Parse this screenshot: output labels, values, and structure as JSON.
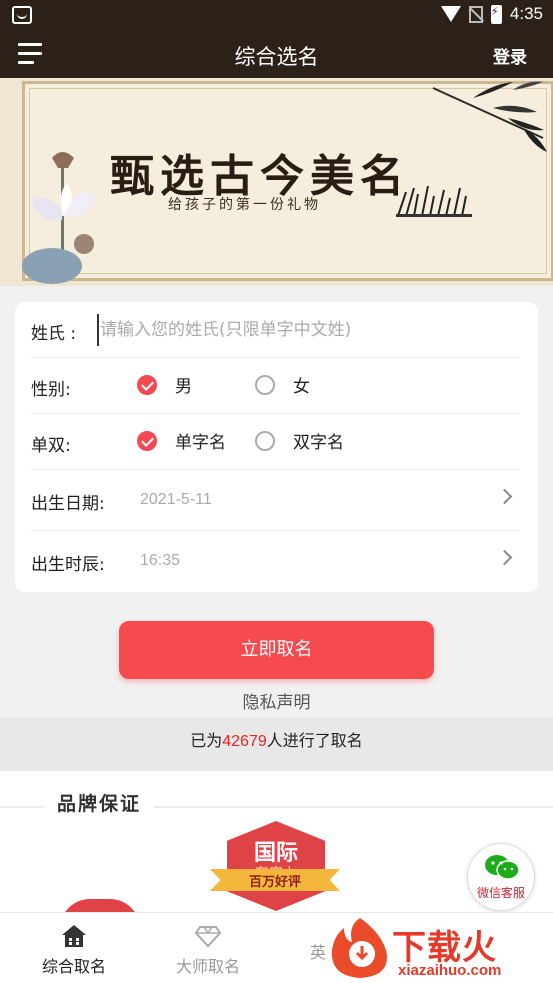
{
  "status_bar": {
    "time": "4:35"
  },
  "app_bar": {
    "title": "综合选名",
    "login_label": "登录"
  },
  "banner": {
    "headline": "甄选古今美名",
    "subline": "给孩子的第一份礼物"
  },
  "form": {
    "surname": {
      "label": "姓氏 :",
      "placeholder": "请输入您的姓氏(只限单字中文姓)",
      "value": ""
    },
    "gender": {
      "label": "性别:",
      "options": [
        {
          "label": "男",
          "checked": true
        },
        {
          "label": "女",
          "checked": false
        }
      ]
    },
    "name_type": {
      "label": "单双:",
      "options": [
        {
          "label": "单字名",
          "checked": true
        },
        {
          "label": "双字名",
          "checked": false
        }
      ]
    },
    "birth_date": {
      "label": "出生日期:",
      "value": "2021-5-11"
    },
    "birth_time": {
      "label": "出生时辰:",
      "value": "16:35"
    }
  },
  "submit_label": "立即取名",
  "privacy_label": "隐私声明",
  "usage_count": {
    "prefix": "已为",
    "number": "42679",
    "suffix": "人进行了取名"
  },
  "brand": {
    "title": "品牌保证",
    "badge_title": "国际",
    "badge_sub": "有实力",
    "badge_ribbon": "百万好评"
  },
  "service_label": "微信客服",
  "bottom_nav": [
    {
      "label": "综合取名",
      "icon": "home-icon",
      "active": true
    },
    {
      "label": "大师取名",
      "icon": "diamond-icon",
      "active": false
    },
    {
      "label": "英",
      "icon": "",
      "active": false
    }
  ],
  "watermark": {
    "text": "下载火",
    "url": "xiazaihuo.com"
  },
  "colors": {
    "app_bar": "#2c2118",
    "accent": "#f54a4e",
    "count_number": "#ee2222"
  }
}
